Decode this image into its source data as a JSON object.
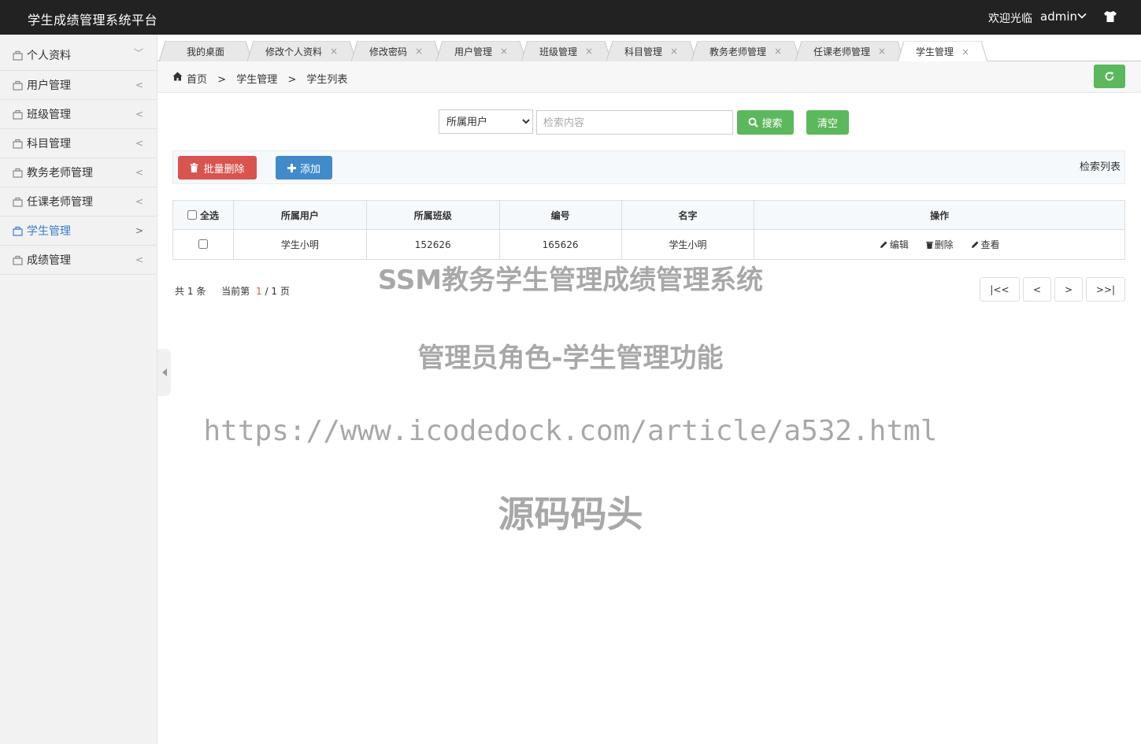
{
  "header": {
    "brand": "学生成绩管理系统平台",
    "welcome": "欢迎光临",
    "username": "admin",
    "user_chevron_icon": "chevron-down-icon",
    "skin_icon": "tshirt-icon"
  },
  "sidebar": {
    "items": [
      {
        "label": "个人资料",
        "arrow": "﹀"
      },
      {
        "label": "用户管理",
        "arrow": "<"
      },
      {
        "label": "班级管理",
        "arrow": "<"
      },
      {
        "label": "科目管理",
        "arrow": "<"
      },
      {
        "label": "教务老师管理",
        "arrow": "<"
      },
      {
        "label": "任课老师管理",
        "arrow": "<"
      },
      {
        "label": "学生管理",
        "arrow": ">"
      },
      {
        "label": "成绩管理",
        "arrow": "<"
      }
    ],
    "active_index": 6,
    "active_color": "#3a7cc9"
  },
  "tabs": [
    {
      "label": "我的桌面",
      "closable": false
    },
    {
      "label": "修改个人资料",
      "closable": true
    },
    {
      "label": "修改密码",
      "closable": true
    },
    {
      "label": "用户管理",
      "closable": true
    },
    {
      "label": "班级管理",
      "closable": true
    },
    {
      "label": "科目管理",
      "closable": true
    },
    {
      "label": "教务老师管理",
      "closable": true
    },
    {
      "label": "任课老师管理",
      "closable": true
    },
    {
      "label": "学生管理",
      "closable": true,
      "active": true
    }
  ],
  "tab_close_glyph": "×",
  "breadcrumb": {
    "home": "首页",
    "sep": ">",
    "level1": "学生管理",
    "level2": "学生列表"
  },
  "search": {
    "select_value": "所属用户",
    "placeholder": "检索内容",
    "search_label": "搜索",
    "clear_label": "清空"
  },
  "toolbar": {
    "batch_delete_label": "批量删除",
    "add_label": "添加",
    "title": "检索列表"
  },
  "table": {
    "select_all_label": "全选",
    "headers": [
      "所属用户",
      "所属班级",
      "编号",
      "名字",
      "操作"
    ],
    "rows": [
      {
        "user": "学生小明",
        "class": "152626",
        "number": "165626",
        "name": "学生小明"
      }
    ],
    "ops": {
      "edit": "编辑",
      "delete": "删除",
      "view": "查看"
    }
  },
  "pager": {
    "total_prefix": "共",
    "total": "1",
    "total_suffix": "条",
    "current_prefix": "当前第",
    "current": "1",
    "slash": "/",
    "pages": "1",
    "pages_suffix": "页",
    "first": "|<<",
    "prev": "<",
    "next": ">",
    "last": ">>|"
  },
  "watermark": {
    "line1": "SSM教务学生管理成绩管理系统",
    "line2": "管理员角色-学生管理功能",
    "line3": "https://www.icodedock.com/article/a532.html",
    "line4": "源码码头"
  },
  "colors": {
    "header_bg": "#222222",
    "success": "#5cb85c",
    "danger": "#d9534f",
    "primary": "#428bca"
  }
}
